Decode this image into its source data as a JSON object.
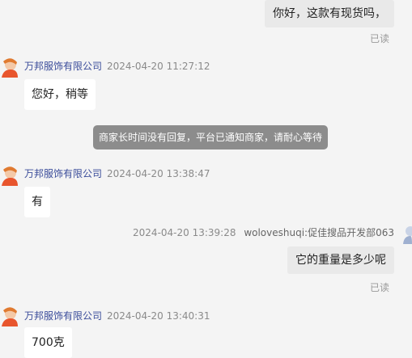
{
  "messages": [
    {
      "type": "user",
      "text": "你好，这款有现货吗，",
      "status": "已读"
    },
    {
      "type": "merchant",
      "sender": "万邦服饰有限公司",
      "time": "2024-04-20 11:27:12",
      "text": "您好，稍等"
    },
    {
      "type": "system",
      "text": "商家长时间没有回复，平台已通知商家，请耐心等待"
    },
    {
      "type": "merchant",
      "sender": "万邦服饰有限公司",
      "time": "2024-04-20 13:38:47",
      "text": "有"
    },
    {
      "type": "user",
      "time": "2024-04-20 13:39:28",
      "sender": "woloveshuqi:促佳搜品开发部063",
      "text": "它的重量是多少呢",
      "status": "已读"
    },
    {
      "type": "merchant",
      "sender": "万邦服饰有限公司",
      "time": "2024-04-20 13:40:31",
      "text": "700克"
    }
  ],
  "colors": {
    "background": "#f4f4f4",
    "user_bubble": "#e9e9e9",
    "merchant_bubble": "#ffffff",
    "merchant_name": "#3a4c9a",
    "system_notice": "#8c8c8c"
  },
  "icons": {
    "merchant_avatar": "merchant-avatar-icon",
    "user_avatar": "user-avatar-icon"
  }
}
